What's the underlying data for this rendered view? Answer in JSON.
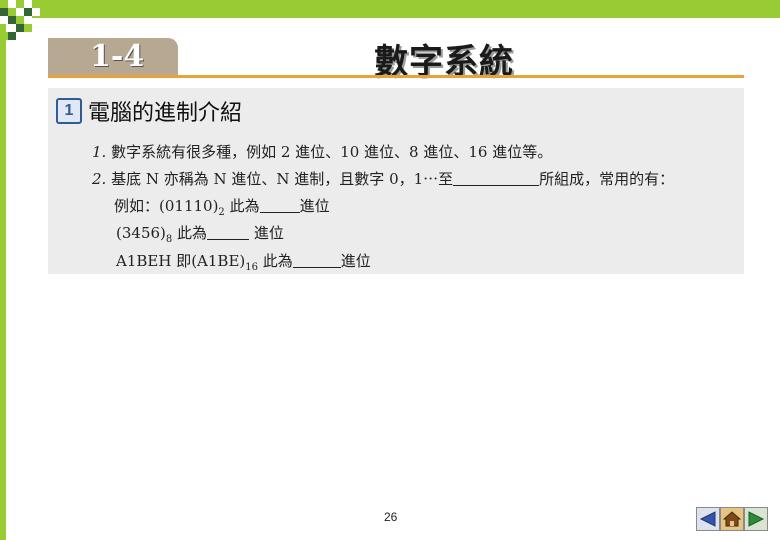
{
  "header": {
    "section_number": "1-4",
    "title": "數字系統"
  },
  "content": {
    "badge": "1",
    "heading": "電腦的進制介紹",
    "line1": {
      "num": "1.",
      "text": "數字系統有很多種，例如 2 進位、10 進位、8 進位、16 進位等。"
    },
    "line2": {
      "num": "2.",
      "text_before": "基底 N 亦稱為 N 進位、N 進制，且數字 0，1⋯至",
      "text_after": "所組成，常用的有："
    },
    "example1": {
      "prefix": "例如：(01110)",
      "sub": "2",
      "mid": " 此為",
      "suffix": "進位"
    },
    "example2": {
      "prefix": "(3456)",
      "sub": "8",
      "mid": " 此為",
      "suffix": " 進位"
    },
    "example3": {
      "prefix": "A1BEH 即(A1BE)",
      "sub": "16",
      "mid": " 此為",
      "suffix": "進位"
    }
  },
  "footer": {
    "page_number": "26",
    "nav": [
      "prev-icon",
      "home-icon",
      "next-icon"
    ]
  },
  "colors": {
    "green": "#99cc33",
    "dark_green": "#336633",
    "accent_line": "#e8a23c",
    "tab": "#b7a891"
  }
}
